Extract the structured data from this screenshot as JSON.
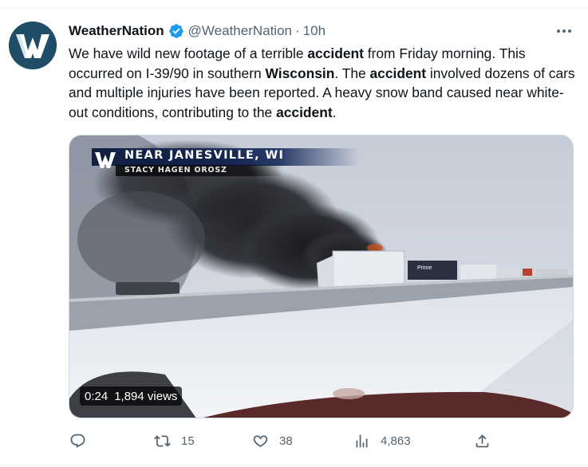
{
  "author": {
    "display_name": "WeatherNation",
    "handle": "@WeatherNation",
    "separator": "·",
    "time": "10h",
    "verified": true,
    "avatar_logo": "weathernation-w-logo",
    "avatar_color": "#1f4c66",
    "verified_color": "#1d9bf0"
  },
  "tweet": {
    "segments": [
      {
        "text": "We have wild new footage of a terrible ",
        "bold": false
      },
      {
        "text": "accident",
        "bold": true
      },
      {
        "text": " from Friday morning. This occurred on I-39/90 in southern ",
        "bold": false
      },
      {
        "text": "Wisconsin",
        "bold": true
      },
      {
        "text": ". The ",
        "bold": false
      },
      {
        "text": "accident",
        "bold": true
      },
      {
        "text": " involved dozens of cars and multiple injuries have been reported. A heavy snow band caused near white-out conditions, contributing to the ",
        "bold": false
      },
      {
        "text": "accident",
        "bold": true
      },
      {
        "text": ".",
        "bold": false
      }
    ]
  },
  "video": {
    "overlay_title": "NEAR JANESVILLE, WI",
    "overlay_subtitle": "STACY HAGEN OROSZ",
    "duration": "0:24",
    "views": "1,894 views",
    "trailer_text": "Prime"
  },
  "actions": {
    "reply": {
      "icon": "reply-icon",
      "count": ""
    },
    "retweet": {
      "icon": "retweet-icon",
      "count": "15"
    },
    "like": {
      "icon": "heart-icon",
      "count": "38"
    },
    "views": {
      "icon": "views-chart-icon",
      "count": "4,863"
    },
    "share": {
      "icon": "share-icon",
      "count": ""
    }
  },
  "colors": {
    "text_primary": "#0f1419",
    "text_secondary": "#536471",
    "border": "#cfd9de"
  }
}
